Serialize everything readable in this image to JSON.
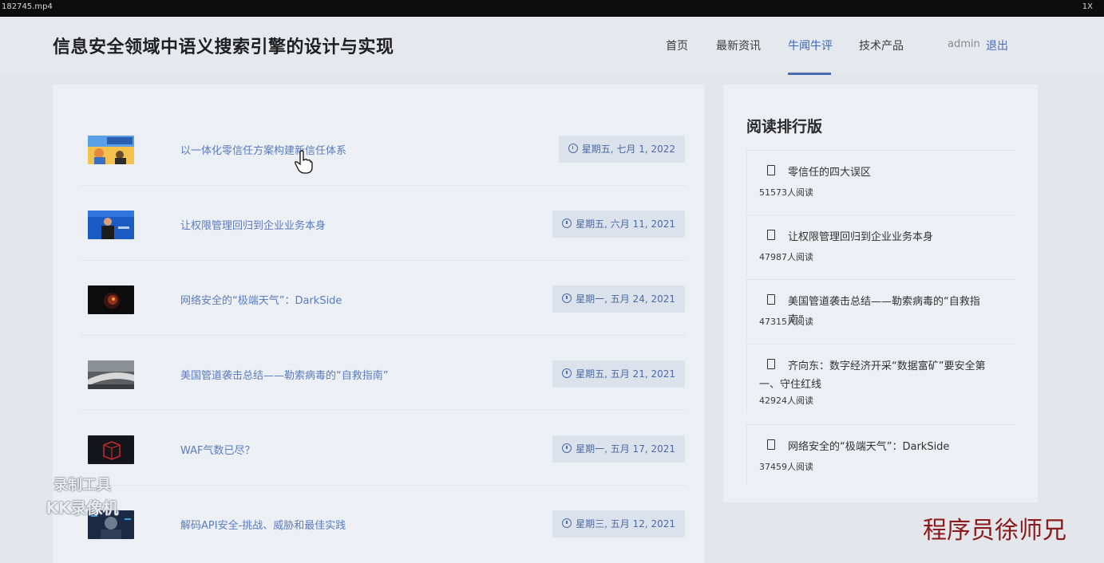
{
  "player": {
    "filename": "182745.mp4",
    "speed": "1X"
  },
  "header": {
    "site_title": "信息安全领域中语义搜索引擎的设计与实现",
    "nav": [
      {
        "label": "首页",
        "active": false
      },
      {
        "label": "最新资讯",
        "active": false
      },
      {
        "label": "牛闻牛评",
        "active": true
      },
      {
        "label": "技术产品",
        "active": false
      }
    ],
    "user": "admin",
    "logout": "退出"
  },
  "articles": [
    {
      "title": "以一体化零信任方案构建新信任体系",
      "date": "星期五, 七月 1, 2022",
      "thumb": "news-banner"
    },
    {
      "title": "让权限管理回归到企业业务本身",
      "date": "星期五, 六月 11, 2021",
      "thumb": "speaker"
    },
    {
      "title": "网络安全的“极端天气”：DarkSide",
      "date": "星期一, 五月 24, 2021",
      "thumb": "dark-sphere"
    },
    {
      "title": "美国管道袭击总结——勒索病毒的“自救指南”",
      "date": "星期五, 五月 21, 2021",
      "thumb": "pipeline"
    },
    {
      "title": "WAF气数已尽？",
      "date": "星期一, 五月 17, 2021",
      "thumb": "red-cube"
    },
    {
      "title": "解码API安全-挑战、威胁和最佳实践",
      "date": "星期三, 五月 12, 2021",
      "thumb": "hacker"
    }
  ],
  "ranking": {
    "title": "阅读排行版",
    "items": [
      {
        "title": "零信任的四大误区",
        "count": "51573人阅读"
      },
      {
        "title": "让权限管理回归到企业业务本身",
        "count": "47987人阅读"
      },
      {
        "title": "美国管道袭击总结——勒索病毒的“自救指南”",
        "count": "47315人阅读"
      },
      {
        "title": "齐向东：数字经济开采“数据富矿”要安全第一、守住红线",
        "count": "42924人阅读"
      },
      {
        "title": "网络安全的“极端天气”：DarkSide",
        "count": "37459人阅读"
      }
    ]
  },
  "watermarks": {
    "tool_line1": "录制工具",
    "tool_line2": "KK录像机",
    "author": "程序员徐师兄"
  },
  "colors": {
    "accent": "#4a6cb8",
    "link": "#5a7cc0",
    "badge_bg": "#dbe2ec",
    "author_watermark": "#8b1a1a"
  }
}
